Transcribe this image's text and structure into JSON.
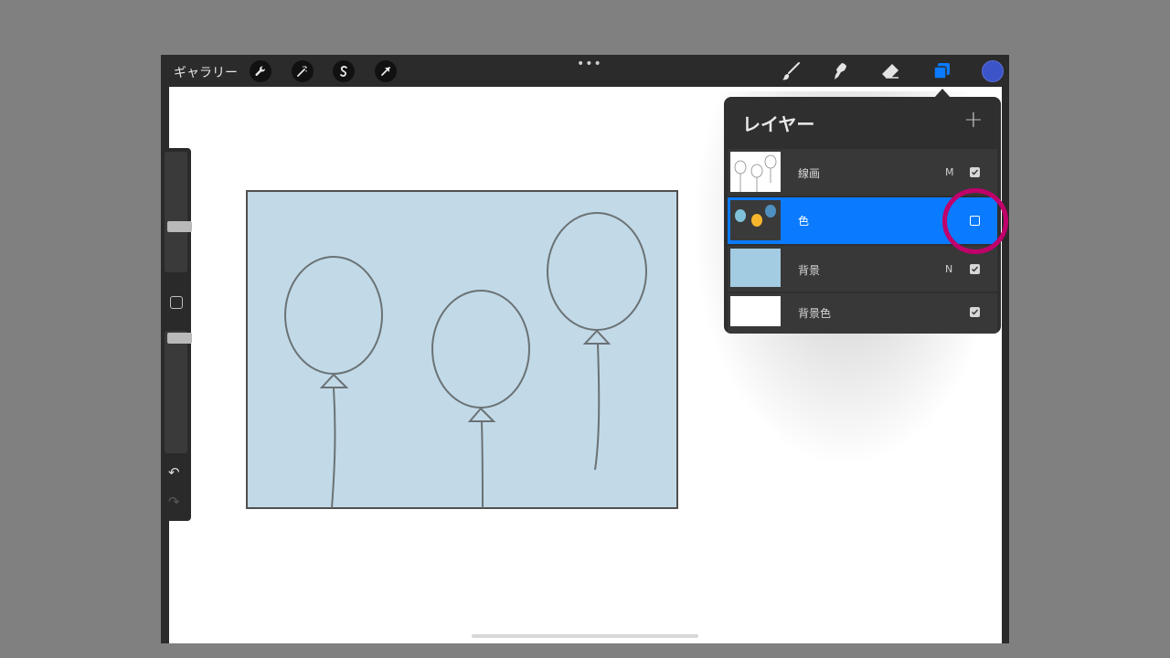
{
  "topbar": {
    "gallery_label": "ギャラリー",
    "more_label": "•••",
    "left_tools": [
      "wrench-icon",
      "magic-wand-icon",
      "selection-icon",
      "transform-icon"
    ],
    "right_tools": [
      "brush-icon",
      "smudge-icon",
      "eraser-icon",
      "layers-icon"
    ],
    "current_color": "#3b55c8"
  },
  "layers_panel": {
    "title": "レイヤー",
    "add_label": "+",
    "layers": [
      {
        "name": "線画",
        "mode": "M",
        "visible": true,
        "active": false
      },
      {
        "name": "色",
        "mode": "",
        "visible": false,
        "active": true
      },
      {
        "name": "背景",
        "mode": "N",
        "visible": true,
        "active": false
      },
      {
        "name": "背景色",
        "mode": "",
        "visible": true,
        "active": false
      }
    ]
  },
  "colors": {
    "accent": "#0a7bff",
    "highlight_ring": "#c0006a",
    "artwork_fill": "#c2d9e8"
  },
  "sidebar": {
    "undo_icon": "↶",
    "redo_icon": "↷"
  }
}
